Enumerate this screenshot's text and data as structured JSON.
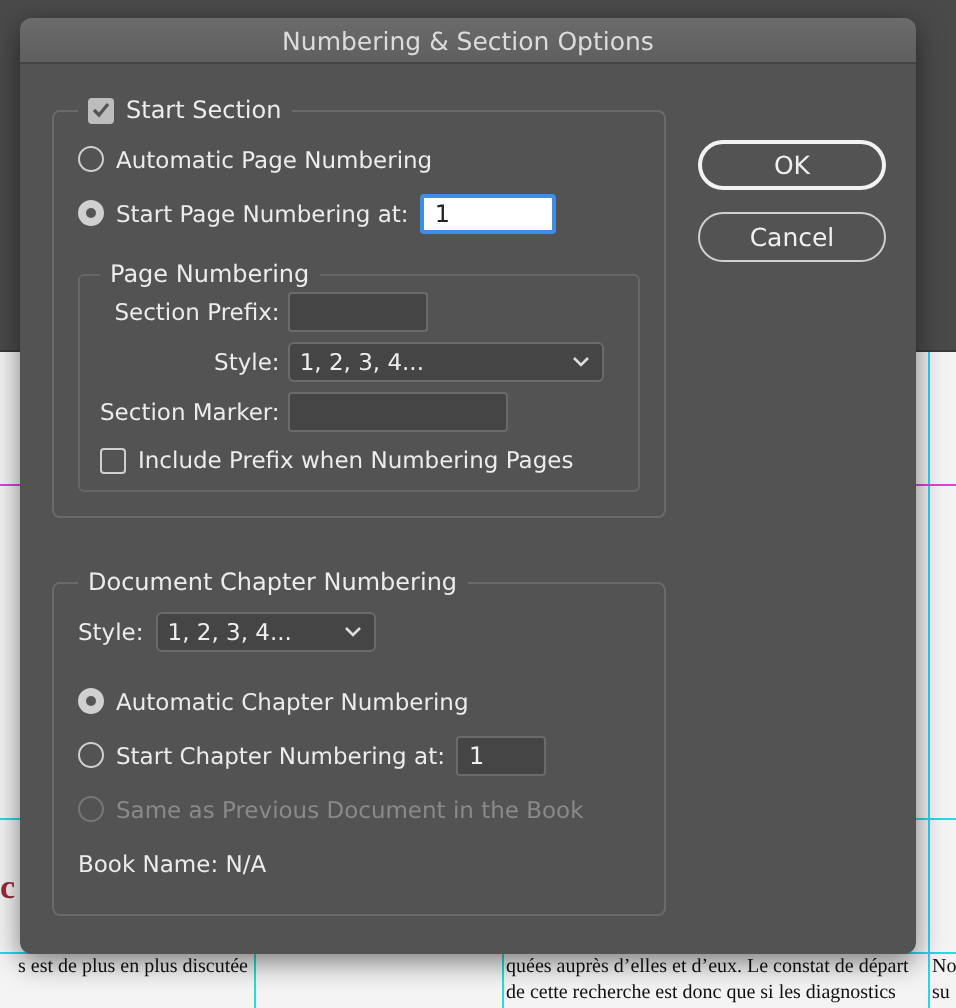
{
  "document": {
    "heading_fragment": "c",
    "column_1": [
      "s est de plus en plus discutée"
    ],
    "column_2": [
      "quées auprès d’elles et d’eux. Le constat de départ",
      "de cette recherche est donc que si les diagnostics"
    ],
    "column_3": [
      "No",
      "su"
    ]
  },
  "dialog": {
    "title": "Numbering & Section Options",
    "start_section": {
      "label": "Start Section",
      "checked": true
    },
    "page_numbering_options": [
      {
        "label": "Automatic Page Numbering",
        "selected": false
      },
      {
        "label": "Start Page Numbering at:",
        "selected": true,
        "value": "1"
      }
    ],
    "page_numbering": {
      "title": "Page Numbering",
      "section_prefix": {
        "label": "Section Prefix:"
      },
      "style": {
        "label": "Style:",
        "value": "1, 2, 3, 4..."
      },
      "section_marker": {
        "label": "Section Marker:"
      },
      "include_prefix": {
        "label": "Include Prefix when Numbering Pages",
        "checked": false
      }
    },
    "chapter_numbering": {
      "title": "Document Chapter Numbering",
      "style": {
        "label": "Style:",
        "value": "1, 2, 3, 4..."
      },
      "options": [
        {
          "label": "Automatic Chapter Numbering",
          "selected": true,
          "disabled": false
        },
        {
          "label": "Start Chapter Numbering at:",
          "selected": false,
          "disabled": false,
          "value": "1"
        },
        {
          "label": "Same as Previous Document in the Book",
          "selected": false,
          "disabled": true
        }
      ],
      "book_name": "Book Name: N/A"
    },
    "buttons": [
      {
        "label": "OK",
        "default": true
      },
      {
        "label": "Cancel",
        "default": false
      }
    ]
  }
}
